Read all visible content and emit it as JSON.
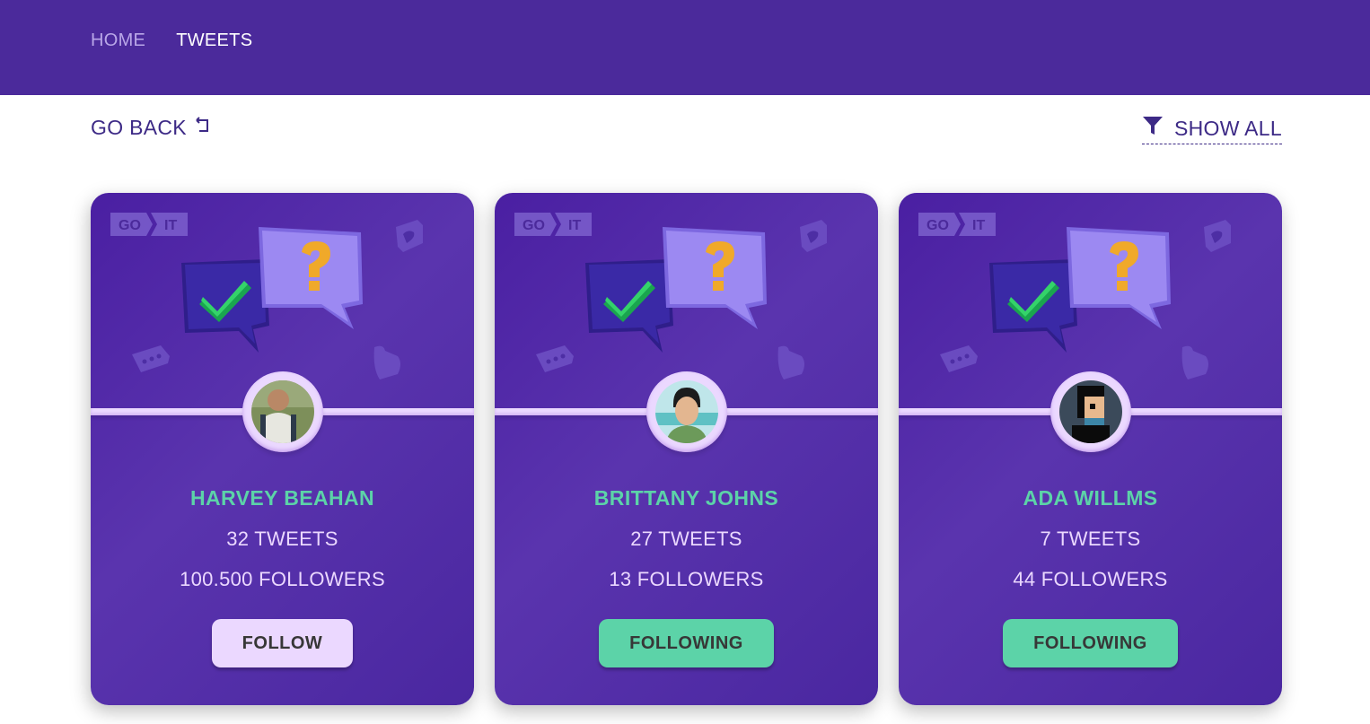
{
  "nav": {
    "home_label": "HOME",
    "tweets_label": "TWEETS"
  },
  "toolbar": {
    "go_back_label": "GO BACK",
    "show_all_label": "SHOW ALL"
  },
  "card_art": {
    "logo_left": "GO",
    "logo_right": "IT"
  },
  "users": [
    {
      "name": "HARVEY BEAHAN",
      "tweets": "32 TWEETS",
      "followers": "100.500 FOLLOWERS",
      "button_label": "FOLLOW",
      "following": false
    },
    {
      "name": "BRITTANY JOHNS",
      "tweets": "27 TWEETS",
      "followers": "13 FOLLOWERS",
      "button_label": "FOLLOWING",
      "following": true
    },
    {
      "name": "ADA WILLMS",
      "tweets": "7 TWEETS",
      "followers": "44 FOLLOWERS",
      "button_label": "FOLLOWING",
      "following": true
    }
  ],
  "colors": {
    "header": "#4b2a9b",
    "card": "#5736a7",
    "accent_name": "#5cd3a8",
    "follow_button": "#ebd8ff",
    "following_button": "#5cd3a8",
    "link": "#3d2a86"
  },
  "icons": {
    "go_back": "return-arrow-icon",
    "show_all": "filter-icon"
  }
}
